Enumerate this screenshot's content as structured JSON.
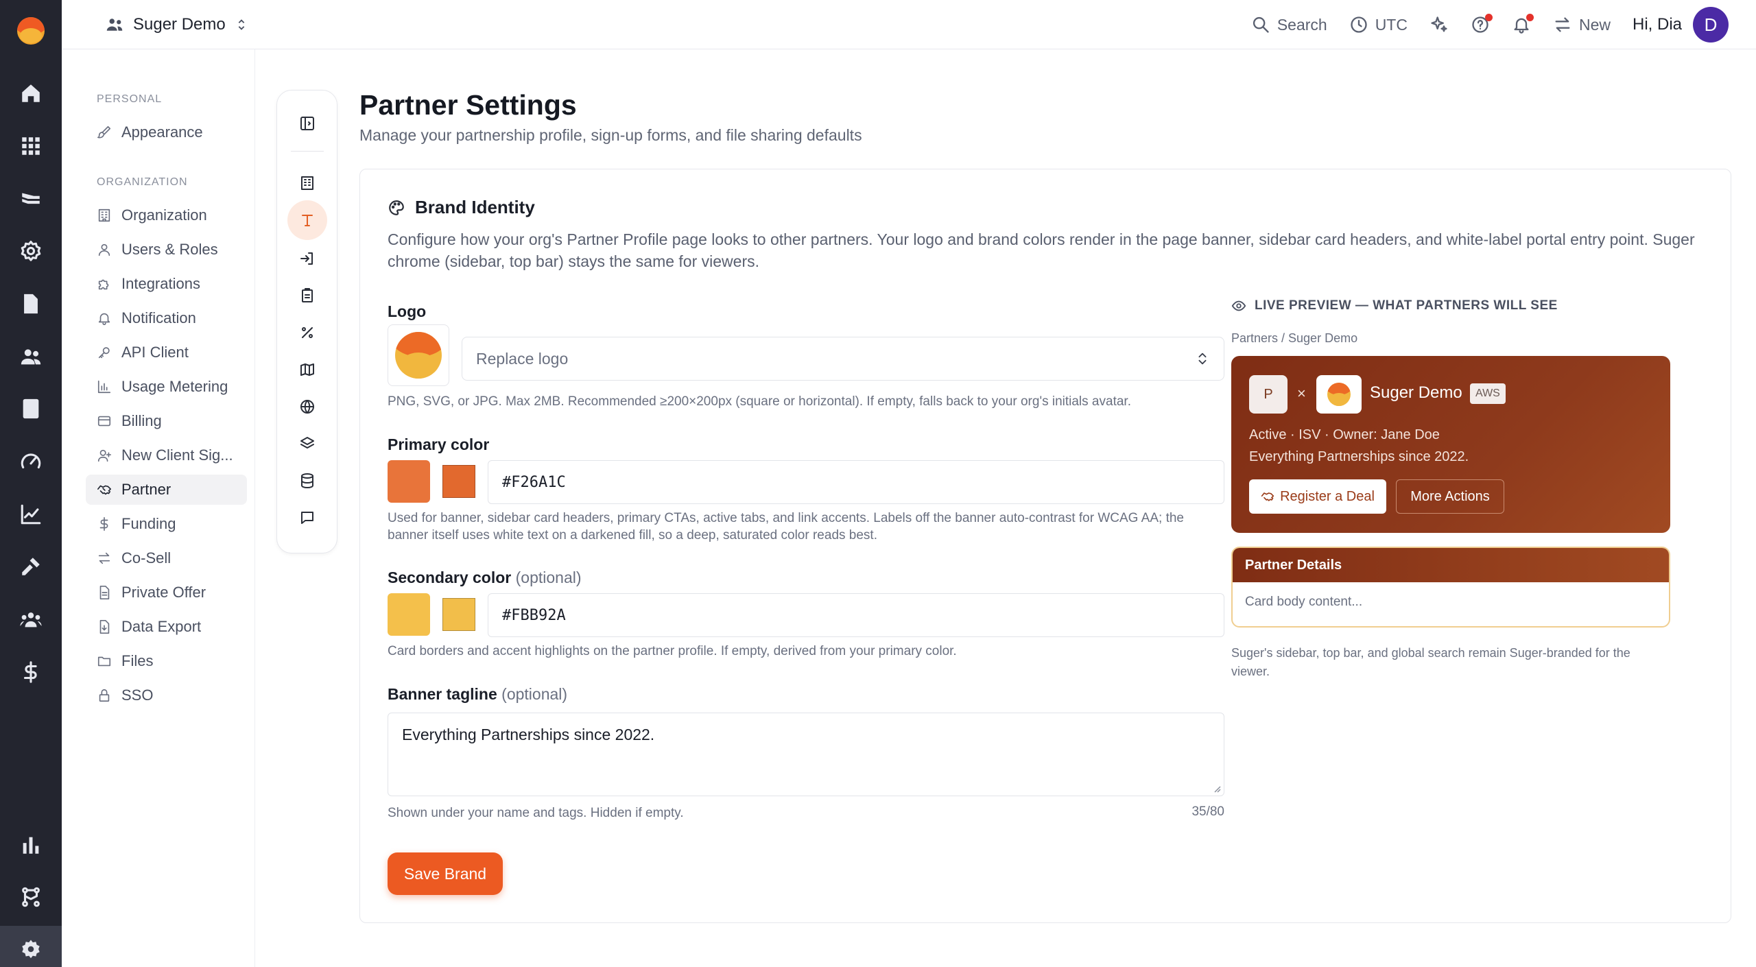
{
  "topbar": {
    "org_name": "Suger Demo",
    "search_label": "Search",
    "timezone": "UTC",
    "new_label": "New",
    "greeting": "Hi, Dia",
    "avatar_initial": "D"
  },
  "settings_nav": {
    "personal_label": "PERSONAL",
    "organization_label": "ORGANIZATION",
    "personal_items": [
      {
        "label": "Appearance",
        "icon": "brush-icon"
      }
    ],
    "org_items": [
      {
        "label": "Organization",
        "icon": "building-icon"
      },
      {
        "label": "Users & Roles",
        "icon": "users-icon"
      },
      {
        "label": "Integrations",
        "icon": "puzzle-icon"
      },
      {
        "label": "Notification",
        "icon": "bell-icon"
      },
      {
        "label": "API Client",
        "icon": "key-icon"
      },
      {
        "label": "Usage Metering",
        "icon": "bar-chart-icon"
      },
      {
        "label": "Billing",
        "icon": "credit-card-icon"
      },
      {
        "label": "New Client Sig...",
        "icon": "user-plus-icon"
      },
      {
        "label": "Partner",
        "icon": "handshake-icon",
        "active": true
      },
      {
        "label": "Funding",
        "icon": "dollar-icon"
      },
      {
        "label": "Co-Sell",
        "icon": "arrows-swap-icon"
      },
      {
        "label": "Private Offer",
        "icon": "document-icon"
      },
      {
        "label": "Data Export",
        "icon": "file-download-icon"
      },
      {
        "label": "Files",
        "icon": "folder-icon"
      },
      {
        "label": "SSO",
        "icon": "lock-icon"
      }
    ]
  },
  "page": {
    "title": "Partner Settings",
    "subtitle": "Manage your partnership profile, sign-up forms, and file sharing defaults"
  },
  "brand": {
    "title": "Brand Identity",
    "description": "Configure how your org's Partner Profile page looks to other partners. Your logo and brand colors render in the page banner, sidebar card headers, and white-label portal entry point. Suger chrome (sidebar, top bar) stays the same for viewers.",
    "logo_label": "Logo",
    "logo_placeholder": "Replace logo",
    "logo_help": "PNG, SVG, or JPG. Max 2MB. Recommended ≥200×200px (square or horizontal). If empty, falls back to your org's initials avatar.",
    "primary_label": "Primary color",
    "primary_value": "#F26A1C",
    "primary_help": "Used for banner, sidebar card headers, primary CTAs, active tabs, and link accents. Labels off the banner auto-contrast for WCAG AA; the banner itself uses white text on a darkened fill, so a deep, saturated color reads best.",
    "secondary_label": "Secondary color",
    "optional_label": "(optional)",
    "secondary_value": "#FBB92A",
    "secondary_help": "Card borders and accent highlights on the partner profile. If empty, derived from your primary color.",
    "tagline_label": "Banner tagline",
    "tagline_value": "Everything Partnerships since 2022.",
    "tagline_help": "Shown under your name and tags. Hidden if empty.",
    "tagline_counter": "35/80",
    "save_label": "Save Brand"
  },
  "preview": {
    "heading": "LIVE PREVIEW — WHAT PARTNERS WILL SEE",
    "breadcrumb": "Partners / Suger Demo",
    "partner_initial": "P",
    "times": "×",
    "org_name": "Suger Demo",
    "cloud_tag": "AWS",
    "meta": "Active · ISV · Owner: Jane Doe",
    "tagline": "Everything Partnerships since 2022.",
    "register_label": "Register a Deal",
    "more_label": "More Actions",
    "details_title": "Partner Details",
    "details_body": "Card body content...",
    "note": "Suger's sidebar, top bar, and global search remain Suger-branded for the viewer."
  },
  "colors": {
    "primary_swatch": "#E8743A",
    "secondary_swatch": "#F4C04B",
    "accent": "#EC5A22",
    "rail": "#23252F"
  }
}
